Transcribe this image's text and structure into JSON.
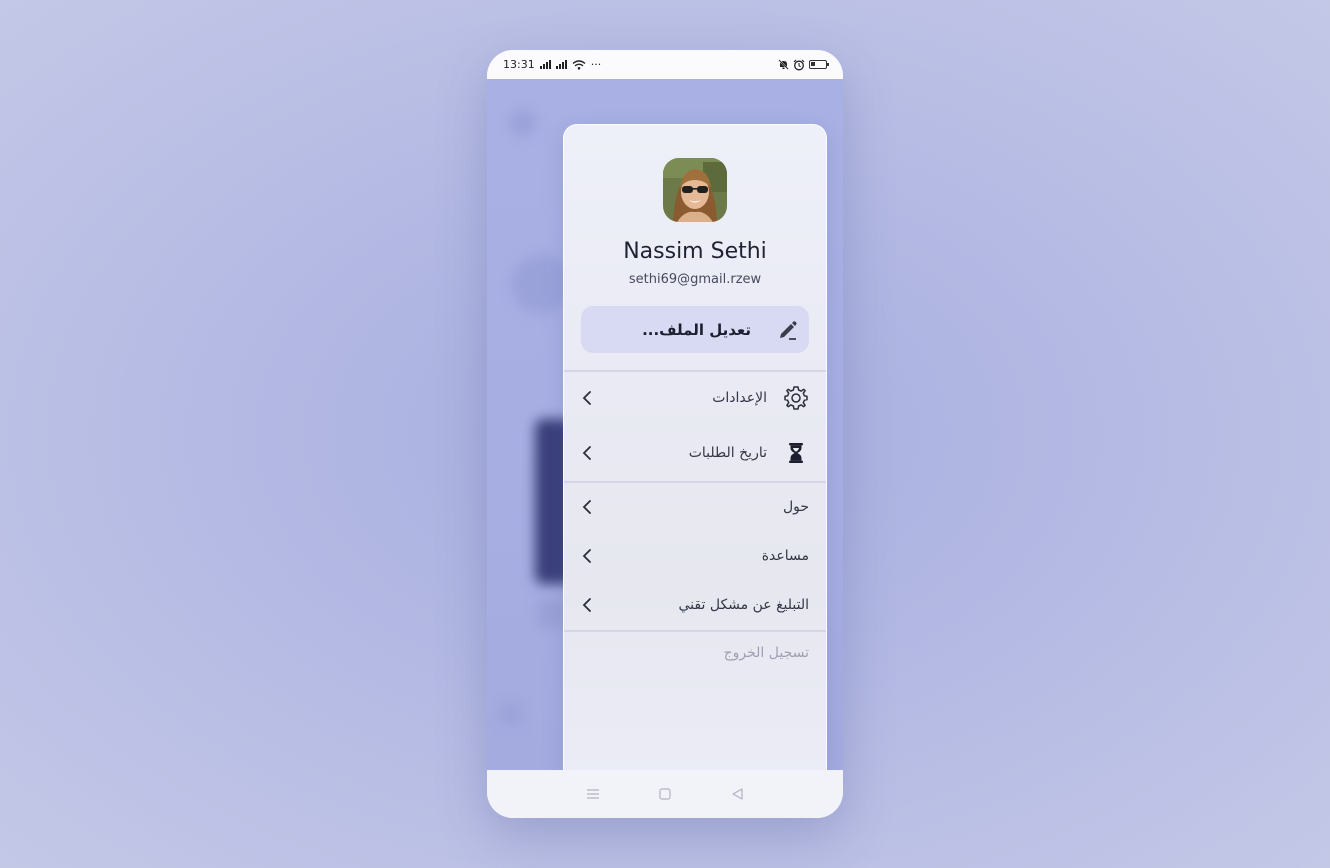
{
  "status_bar": {
    "time": "13:31",
    "more": "···"
  },
  "profile": {
    "name": "Nassim Sethi",
    "email": "sethi69@gmail.rzew",
    "edit_button_label": "تعديل الملف..."
  },
  "menu": {
    "items": [
      {
        "label": "الإعدادات",
        "icon": "gear-icon"
      },
      {
        "label": "تاريخ الطلبات",
        "icon": "hourglass-icon"
      },
      {
        "label": "حول",
        "icon": ""
      },
      {
        "label": "مساعدة",
        "icon": ""
      },
      {
        "label": "التبليغ عن مشكل تقني",
        "icon": ""
      }
    ],
    "logout_label": "تسجيل الخروج"
  },
  "nav_bar": {
    "icons": [
      "menu-icon",
      "home-square-icon",
      "back-triangle-icon"
    ]
  },
  "colors": {
    "accent": "#d8d9f3",
    "background": "#a9b1e4",
    "text_primary": "#1f2233",
    "text_muted": "#9ea1b3"
  }
}
